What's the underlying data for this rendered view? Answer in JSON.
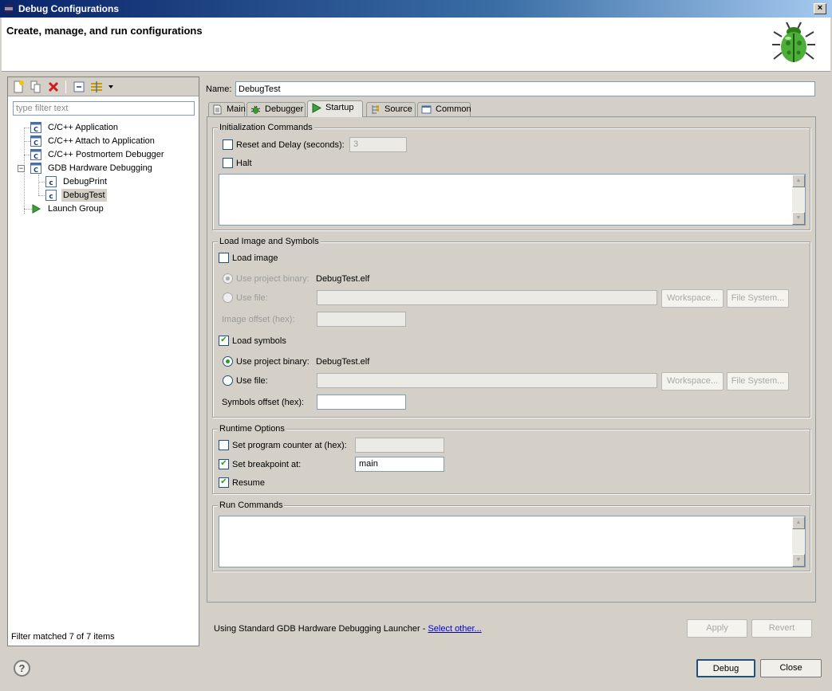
{
  "window": {
    "title": "Debug Configurations",
    "close_glyph": "×"
  },
  "header": {
    "title": "Create, manage, and run configurations",
    "icon": "bug-icon"
  },
  "left_panel": {
    "filter_placeholder": "type filter text",
    "tree": [
      {
        "label": "C/C++ Application",
        "icon": "c-config-icon"
      },
      {
        "label": "C/C++ Attach to Application",
        "icon": "c-config-icon"
      },
      {
        "label": "C/C++ Postmortem Debugger",
        "icon": "c-config-icon"
      },
      {
        "label": "GDB Hardware Debugging",
        "icon": "c-config-icon",
        "expanded": true,
        "children": [
          {
            "label": "DebugPrint",
            "icon": "c-file-icon"
          },
          {
            "label": "DebugTest",
            "icon": "c-file-icon",
            "selected": true
          }
        ]
      },
      {
        "label": "Launch Group",
        "icon": "launch-group-icon"
      }
    ],
    "status": "Filter matched 7 of 7 items"
  },
  "config": {
    "name_label": "Name:",
    "name_value": "DebugTest",
    "tabs": [
      {
        "label": "Main",
        "icon": "main-tab-icon"
      },
      {
        "label": "Debugger",
        "icon": "debugger-tab-icon"
      },
      {
        "label": "Startup",
        "icon": "startup-tab-icon",
        "active": true
      },
      {
        "label": "Source",
        "icon": "source-tab-icon"
      },
      {
        "label": "Common",
        "icon": "common-tab-icon"
      }
    ]
  },
  "startup": {
    "init": {
      "title": "Initialization Commands",
      "reset_label": "Reset and Delay (seconds):",
      "reset_checked": false,
      "reset_value": "3",
      "halt_label": "Halt",
      "halt_checked": false
    },
    "load": {
      "title": "Load Image and Symbols",
      "load_image_label": "Load image",
      "load_image_checked": false,
      "img_use_project_label": "Use project binary:",
      "img_project_binary": "DebugTest.elf",
      "img_use_file_label": "Use file:",
      "img_offset_label": "Image offset (hex):",
      "load_symbols_label": "Load symbols",
      "load_symbols_checked": true,
      "sym_use_project_label": "Use project binary:",
      "sym_project_binary": "DebugTest.elf",
      "sym_use_file_label": "Use file:",
      "sym_offset_label": "Symbols offset (hex):",
      "workspace_label": "Workspace...",
      "filesystem_label": "File System..."
    },
    "runtime": {
      "title": "Runtime Options",
      "pc_label": "Set program counter at (hex):",
      "pc_checked": false,
      "bp_label": "Set breakpoint at:",
      "bp_checked": true,
      "bp_value": "main",
      "resume_label": "Resume",
      "resume_checked": true
    },
    "run_commands": {
      "title": "Run Commands"
    }
  },
  "footer": {
    "launcher_text": "Using Standard GDB Hardware Debugging Launcher - ",
    "select_other": "Select other...",
    "apply_label": "Apply",
    "revert_label": "Revert",
    "debug_label": "Debug",
    "close_label": "Close",
    "help_glyph": "?"
  },
  "colors": {
    "title_bar": "#0a246a",
    "accent_green": "#21a121",
    "link": "#0000cc"
  }
}
